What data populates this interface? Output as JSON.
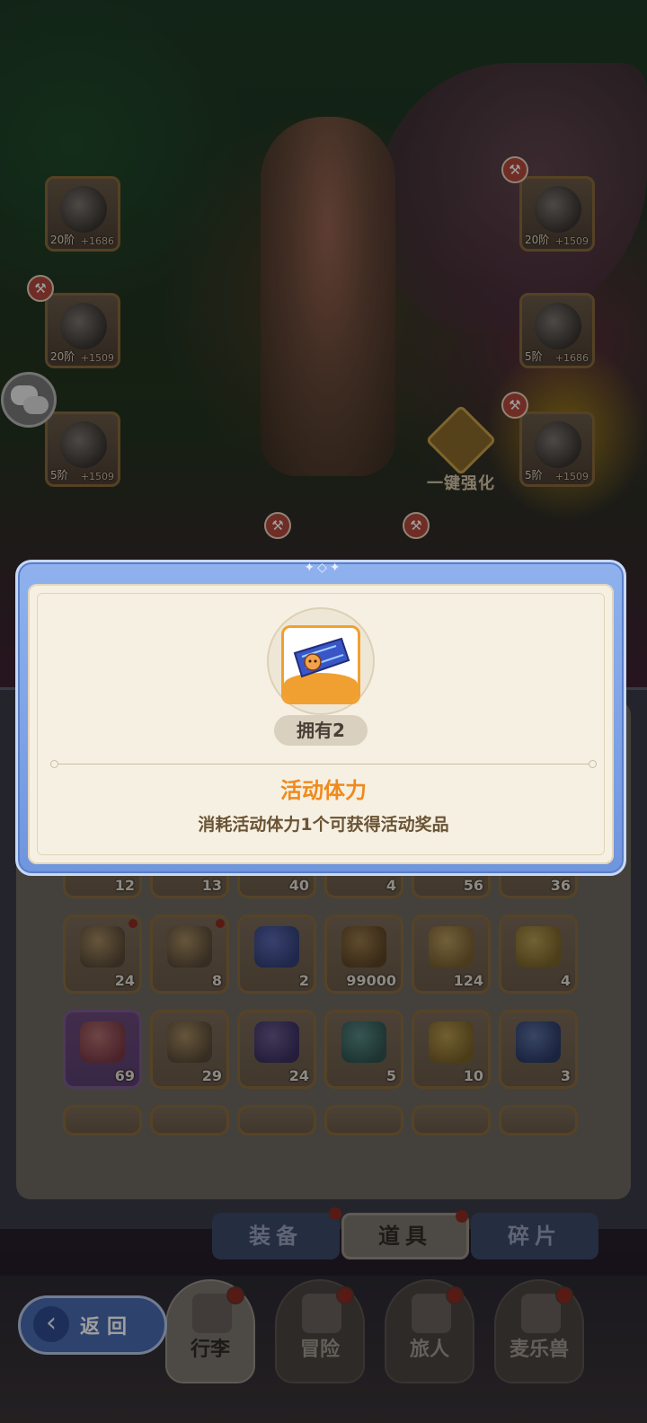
{
  "equipment_slots": [
    {
      "level": "20阶",
      "power": "+1686"
    },
    {
      "level": "20阶",
      "power": "+1509"
    },
    {
      "level": "20阶",
      "power": "+1509"
    },
    {
      "level": "5阶",
      "power": "+1686"
    },
    {
      "level": "5阶",
      "power": "+1509"
    },
    {
      "level": "5阶",
      "power": "+1509"
    }
  ],
  "enhance_label": "一键强化",
  "modal": {
    "owned": "拥有2",
    "title": "活动体力",
    "description": "消耗活动体力1个可获得活动奖品",
    "accent_color": "#ef8a1d"
  },
  "inventory": {
    "partial_row_counts": [
      "12",
      "13",
      "40",
      "4",
      "56",
      "36"
    ],
    "rows": [
      [
        {
          "count": "24",
          "icon": "ingot-icon",
          "dot": true
        },
        {
          "count": "8",
          "icon": "treasure-chest-icon",
          "dot": true
        },
        {
          "count": "2",
          "icon": "stamina-ticket-icon",
          "dot": false
        },
        {
          "count": "99000",
          "icon": "gold-bars-icon",
          "dot": false
        },
        {
          "count": "124",
          "icon": "bowl-icon",
          "dot": false
        },
        {
          "count": "4",
          "icon": "coins-icon",
          "dot": false
        }
      ],
      [
        {
          "count": "69",
          "icon": "pink-creature-icon",
          "dot": false
        },
        {
          "count": "29",
          "icon": "ink-bottle-icon",
          "dot": false
        },
        {
          "count": "24",
          "icon": "ink-bottle-blue-icon",
          "dot": false
        },
        {
          "count": "5",
          "icon": "book-icon",
          "dot": false
        },
        {
          "count": "10",
          "icon": "winged-coin-icon",
          "dot": false
        },
        {
          "count": "3",
          "icon": "mirror-icon",
          "dot": false
        }
      ]
    ]
  },
  "tabs": [
    {
      "label": "装备",
      "active": false
    },
    {
      "label": "道具",
      "active": true
    },
    {
      "label": "碎片",
      "active": false
    }
  ],
  "nav": [
    {
      "label": "行李",
      "active": true
    },
    {
      "label": "冒险",
      "active": false
    },
    {
      "label": "旅人",
      "active": false
    },
    {
      "label": "麦乐兽",
      "active": false
    }
  ],
  "back_label": "返回"
}
